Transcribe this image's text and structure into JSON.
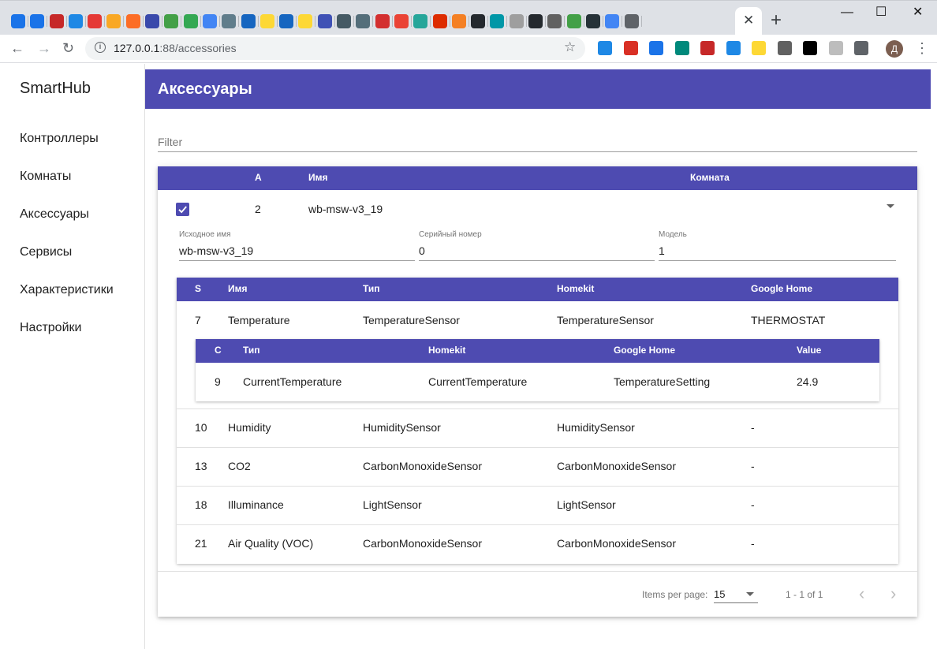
{
  "browser": {
    "url_host": "127.0.0.1",
    "url_rest": ":88/accessories",
    "tab_close": "✕",
    "new_tab": "+",
    "window": {
      "minimize": "—",
      "maximize": "☐",
      "close": "✕"
    },
    "nav": {
      "back": "←",
      "forward": "→",
      "reload": "↻"
    },
    "star": "☆",
    "avatar": "Д",
    "menu": "⋮",
    "bookmark_icon_colors": [
      "#1a73e8",
      "#1a73e8",
      "#c62828",
      "#1e88e5",
      "#e53935",
      "#f9a825",
      "#fc6d26",
      "#3949ab",
      "#43a047",
      "#34a853",
      "#4285f4",
      "#607d8b",
      "#1565c0",
      "#fdd835",
      "#1565c0",
      "#fdd835",
      "#3f51b5",
      "#455a64",
      "#546e7a",
      "#d32f2f",
      "#ea4335",
      "#26a69a",
      "#dd2c00",
      "#f48024",
      "#24292e",
      "#0097a7",
      "#9e9e9e",
      "#24292e",
      "#616161",
      "#43a047",
      "#263238",
      "#4285f4",
      "#5f6368"
    ],
    "extension_icon_colors": [
      "#1e88e5",
      "#d93025",
      "#1a73e8",
      "#00897b",
      "#c62828",
      "#1e88e5",
      "#fdd835",
      "#616161",
      "#000000",
      "#bdbdbd",
      "#5f6368"
    ]
  },
  "sidebar": {
    "brand": "SmartHub",
    "items": [
      {
        "label": "Контроллеры"
      },
      {
        "label": "Комнаты"
      },
      {
        "label": "Аксессуары"
      },
      {
        "label": "Сервисы"
      },
      {
        "label": "Характеристики"
      },
      {
        "label": "Настройки"
      }
    ]
  },
  "page": {
    "title": "Аксессуары"
  },
  "filter": {
    "placeholder": "Filter"
  },
  "accessories_table": {
    "headers": {
      "a": "A",
      "name": "Имя",
      "room": "Комната"
    },
    "row": {
      "checked": true,
      "a": "2",
      "name": "wb-msw-v3_19",
      "room": ""
    },
    "details": [
      {
        "label": "Исходное имя",
        "value": "wb-msw-v3_19"
      },
      {
        "label": "Серийный номер",
        "value": "0"
      },
      {
        "label": "Модель",
        "value": "1"
      }
    ]
  },
  "services_table": {
    "headers": {
      "s": "S",
      "name": "Имя",
      "type": "Тип",
      "homekit": "Homekit",
      "google": "Google Home"
    },
    "rows": [
      {
        "s": "7",
        "name": "Temperature",
        "type": "TemperatureSensor",
        "homekit": "TemperatureSensor",
        "google": "THERMOSTAT"
      },
      {
        "s": "10",
        "name": "Humidity",
        "type": "HumiditySensor",
        "homekit": "HumiditySensor",
        "google": "-"
      },
      {
        "s": "13",
        "name": "CO2",
        "type": "CarbonMonoxideSensor",
        "homekit": "CarbonMonoxideSensor",
        "google": "-"
      },
      {
        "s": "18",
        "name": "Illuminance",
        "type": "LightSensor",
        "homekit": "LightSensor",
        "google": "-"
      },
      {
        "s": "21",
        "name": "Air Quality (VOC)",
        "type": "CarbonMonoxideSensor",
        "homekit": "CarbonMonoxideSensor",
        "google": "-"
      }
    ]
  },
  "characteristics_table": {
    "headers": {
      "c": "C",
      "type": "Тип",
      "homekit": "Homekit",
      "google": "Google Home",
      "value": "Value"
    },
    "rows": [
      {
        "c": "9",
        "type": "CurrentTemperature",
        "homekit": "CurrentTemperature",
        "google": "TemperatureSetting",
        "value": "24.9"
      }
    ]
  },
  "paginator": {
    "items_per_page_label": "Items per page:",
    "items_per_page": "15",
    "range": "1 - 1 of 1",
    "prev": "‹",
    "next": "›"
  }
}
